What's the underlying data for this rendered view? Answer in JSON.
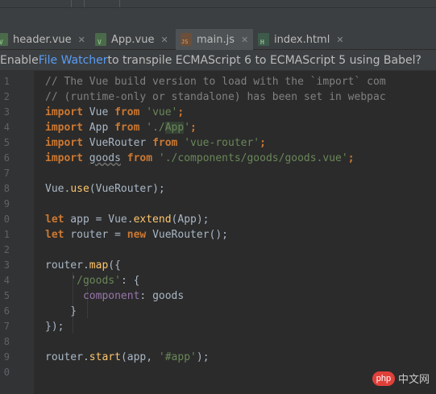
{
  "tabs": [
    {
      "label": "header.vue",
      "icon": "vue-file-icon",
      "active": false,
      "close": "✕"
    },
    {
      "label": "App.vue",
      "icon": "vue-file-icon",
      "active": false,
      "close": "✕"
    },
    {
      "label": "main.js",
      "icon": "js-file-icon",
      "active": true,
      "close": "✕"
    },
    {
      "label": "index.html",
      "icon": "html-file-icon",
      "active": false,
      "close": "✕"
    }
  ],
  "banner": {
    "prefix": "Enable ",
    "link": "File Watcher",
    "suffix": " to transpile ECMAScript 6 to ECMAScript 5 using Babel?"
  },
  "line_numbers": [
    "1",
    "2",
    "3",
    "4",
    "5",
    "6",
    "7",
    "8",
    "9",
    "0",
    "1",
    "2",
    "3",
    "4",
    "5",
    "6",
    "7",
    "8",
    "9",
    "0"
  ],
  "code": {
    "l1": "// The Vue build version to load with the `import` com",
    "l2": "// (runtime-only or standalone) has been set in webpac",
    "l3_kw": "import",
    "l3_id": " Vue ",
    "l3_from": "from",
    "l3_str": " 'vue'",
    "l3_end": ";",
    "l4_kw": "import",
    "l4_id": " App ",
    "l4_from": "from",
    "l4_str1": " './",
    "l4_hl": "App",
    "l4_str2": "'",
    "l4_end": ";",
    "l5_kw": "import",
    "l5_id": " VueRouter ",
    "l5_from": "from",
    "l5_str": " 'vue-router'",
    "l5_end": ";",
    "l6_kw": "import",
    "l6_sp": " ",
    "l6_id": "goods",
    "l6_sp2": " ",
    "l6_from": "from",
    "l6_str": " './components/goods/goods.vue'",
    "l6_end": ";",
    "l8_a": "Vue.",
    "l8_m": "use",
    "l8_b": "(VueRouter);",
    "l10_kw": "let",
    "l10_a": " app = Vue.",
    "l10_m": "extend",
    "l10_b": "(App);",
    "l11_kw": "let",
    "l11_a": " router = ",
    "l11_new": "new",
    "l11_b": " VueRouter();",
    "l13_a": "router.",
    "l13_m": "map",
    "l13_b": "({",
    "l14_sp": "    ",
    "l14_str": "'/goods'",
    "l14_b": ": {",
    "l15_sp": "      ",
    "l15_p": "component",
    "l15_b": ": goods",
    "l16": "    }",
    "l17": "});",
    "l19_a": "router.",
    "l19_m": "start",
    "l19_b": "(app, ",
    "l19_str": "'#app'",
    "l19_c": ");"
  },
  "watermark": {
    "badge": "php",
    "text": "中文网"
  }
}
